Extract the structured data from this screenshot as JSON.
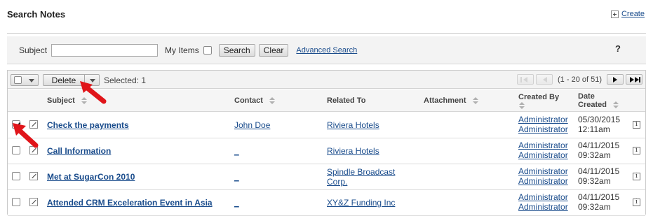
{
  "header": {
    "title": "Search Notes",
    "create_label": "Create"
  },
  "search": {
    "subject_label": "Subject",
    "subject_value": "",
    "subject_placeholder": "",
    "my_items_label": "My Items",
    "search_label": "Search",
    "clear_label": "Clear",
    "advanced_label": "Advanced Search",
    "help_label": "?"
  },
  "toolbar": {
    "delete_label": "Delete",
    "selected_text": "Selected: 1",
    "page_range": "(1 - 20 of 51)"
  },
  "columns": {
    "subject": "Subject",
    "contact": "Contact",
    "related_to": "Related To",
    "attachment": "Attachment",
    "created_by": "Created By",
    "date_created_1": "Date",
    "date_created_2": "Created"
  },
  "rows": [
    {
      "subject": "Check the payments",
      "contact": "John Doe",
      "related_1": "Riviera Hotels",
      "related_2": "",
      "created_by_1": "Administrator",
      "created_by_2": "Administrator",
      "date": "05/30/2015",
      "time": "12:11am",
      "checked": true
    },
    {
      "subject": "Call Information",
      "contact": "_",
      "related_1": "Riviera Hotels",
      "related_2": "",
      "created_by_1": "Administrator",
      "created_by_2": "Administrator",
      "date": "04/11/2015",
      "time": "09:32am",
      "checked": false
    },
    {
      "subject": "Met at SugarCon 2010",
      "contact": "_",
      "related_1": "Spindle Broadcast",
      "related_2": "Corp.",
      "created_by_1": "Administrator",
      "created_by_2": "Administrator",
      "date": "04/11/2015",
      "time": "09:32am",
      "checked": false
    },
    {
      "subject": "Attended CRM Exceleration Event in Asia",
      "contact": "_",
      "related_1": "XY&Z Funding Inc",
      "related_2": "",
      "created_by_1": "Administrator",
      "created_by_2": "Administrator",
      "date": "04/11/2015",
      "time": "09:32am",
      "checked": false
    }
  ],
  "colors": {
    "link": "#1a4c8c",
    "arrow": "#e0151a"
  },
  "icons": {
    "edit": "pencil-icon",
    "info": "info-icon",
    "create": "plus-icon"
  },
  "info_glyph": "i"
}
